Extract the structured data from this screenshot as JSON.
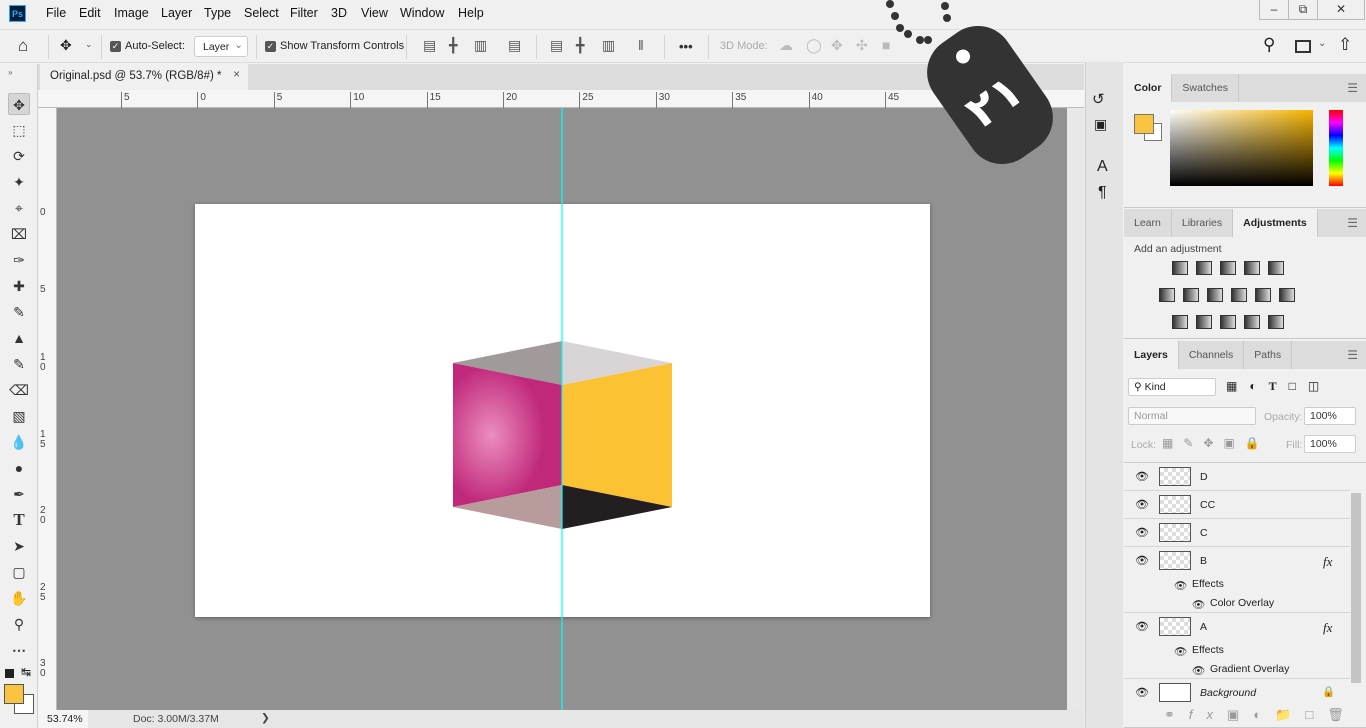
{
  "app": {
    "logo": "Ps",
    "menu": [
      "File",
      "Edit",
      "Image",
      "Layer",
      "Type",
      "Select",
      "Filter",
      "3D",
      "View",
      "Window",
      "Help"
    ],
    "window_controls": [
      "minimize",
      "restore",
      "close"
    ]
  },
  "options": {
    "auto_select_label": "Auto-Select:",
    "auto_select_checked": true,
    "layer_select": "Layer",
    "show_transform_label": "Show Transform Controls",
    "show_transform_checked": true,
    "more": "•••",
    "mode_label": "3D Mode:"
  },
  "document": {
    "tab_title": "Original.psd @ 53.7% (RGB/8#) *",
    "close": "×",
    "zoom": "53.74%",
    "doc_info": "Doc: 3.00M/3.37M",
    "guide_color": "#00ffff"
  },
  "ruler": {
    "top": [
      "5",
      "0",
      "5",
      "10",
      "15",
      "20",
      "25",
      "30",
      "35",
      "40",
      "45"
    ],
    "left": [
      "0",
      "5",
      "10",
      "15",
      "20",
      "25",
      "30"
    ]
  },
  "watermark": {
    "text": "٢١",
    "color": "#333333"
  },
  "colors": {
    "foreground": "#f9c440",
    "background": "#ffffff",
    "cube_left": "#c0287a",
    "cube_right": "#fbc333"
  },
  "color_panel": {
    "tabs": [
      "Color",
      "Swatches"
    ],
    "active": "Color"
  },
  "adjustments_panel": {
    "tabs": [
      "Learn",
      "Libraries",
      "Adjustments"
    ],
    "active": "Adjustments",
    "heading": "Add an adjustment",
    "icons": [
      [
        "brightness-contrast",
        "levels",
        "curves",
        "exposure",
        "vibrance"
      ],
      [
        "hue-saturation",
        "color-balance",
        "black-white",
        "photo-filter",
        "channel-mixer",
        "color-lookup"
      ],
      [
        "invert",
        "posterize",
        "threshold",
        "selective-color",
        "gradient-map"
      ]
    ]
  },
  "layers_panel": {
    "tabs": [
      "Layers",
      "Channels",
      "Paths"
    ],
    "active": "Layers",
    "filter": "Kind",
    "blend_mode": "Normal",
    "opacity_label": "Opacity:",
    "opacity": "100%",
    "lock_label": "Lock:",
    "fill_label": "Fill:",
    "fill": "100%",
    "layers": [
      {
        "name": "D"
      },
      {
        "name": "CC"
      },
      {
        "name": "C"
      },
      {
        "name": "B",
        "fx": "fx",
        "effects_label": "Effects",
        "effects": [
          "Color Overlay"
        ]
      },
      {
        "name": "A",
        "fx": "fx",
        "effects_label": "Effects",
        "effects": [
          "Gradient Overlay"
        ]
      },
      {
        "name": "Background",
        "locked": true
      }
    ]
  }
}
